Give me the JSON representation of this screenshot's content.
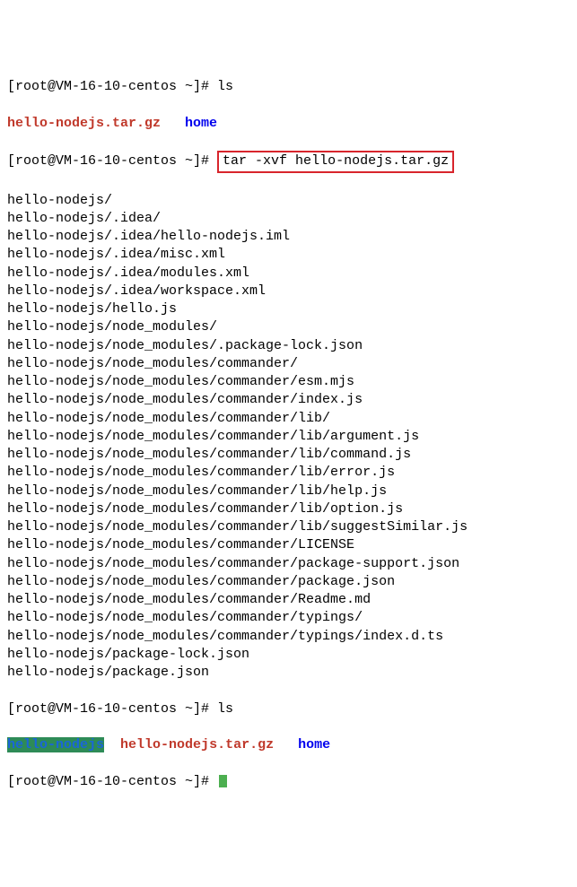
{
  "prompt_host": "[root@VM-16-10-centos ~]# ",
  "cmd_ls": "ls",
  "ls1_tar": "hello-nodejs.tar.gz",
  "ls1_home": "home",
  "cmd_tarbox": "tar -xvf hello-nodejs.tar.gz",
  "tar_out": [
    "hello-nodejs/",
    "hello-nodejs/.idea/",
    "hello-nodejs/.idea/hello-nodejs.iml",
    "hello-nodejs/.idea/misc.xml",
    "hello-nodejs/.idea/modules.xml",
    "hello-nodejs/.idea/workspace.xml",
    "hello-nodejs/hello.js",
    "hello-nodejs/node_modules/",
    "hello-nodejs/node_modules/.package-lock.json",
    "hello-nodejs/node_modules/commander/",
    "hello-nodejs/node_modules/commander/esm.mjs",
    "hello-nodejs/node_modules/commander/index.js",
    "hello-nodejs/node_modules/commander/lib/",
    "hello-nodejs/node_modules/commander/lib/argument.js",
    "hello-nodejs/node_modules/commander/lib/command.js",
    "hello-nodejs/node_modules/commander/lib/error.js",
    "hello-nodejs/node_modules/commander/lib/help.js",
    "hello-nodejs/node_modules/commander/lib/option.js",
    "hello-nodejs/node_modules/commander/lib/suggestSimilar.js",
    "hello-nodejs/node_modules/commander/LICENSE",
    "hello-nodejs/node_modules/commander/package-support.json",
    "hello-nodejs/node_modules/commander/package.json",
    "hello-nodejs/node_modules/commander/Readme.md",
    "hello-nodejs/node_modules/commander/typings/",
    "hello-nodejs/node_modules/commander/typings/index.d.ts",
    "hello-nodejs/package-lock.json",
    "hello-nodejs/package.json"
  ],
  "ls2_dir": "hello-nodejs",
  "ls2_tar": "hello-nodejs.tar.gz",
  "ls2_home": "home"
}
